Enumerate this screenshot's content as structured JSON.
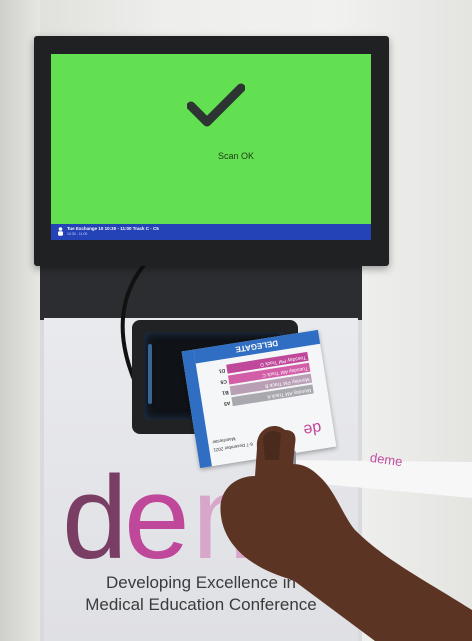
{
  "screen": {
    "status_text": "Scan OK",
    "session_line": "Tue Exchange 10 10:30 - 11:00 Track C - C5",
    "session_time": "10:30 - 11:00",
    "background_color": "#63e051",
    "icon": "checkmark-icon"
  },
  "badge": {
    "role": "DELEGATE",
    "rows": [
      {
        "track": "Monday AM Track A",
        "slot": "A5"
      },
      {
        "track": "Monday PM Track B",
        "slot": "B1"
      },
      {
        "track": "Tuesday AM Track C",
        "slot": "C5"
      },
      {
        "track": "Tuesday PM Track D",
        "slot": "D1"
      }
    ],
    "event_dates": "6-7 December 2021",
    "event_city": "Manchester",
    "accent_color": "#2f6ec2"
  },
  "stand": {
    "logo_text": "deme",
    "tagline_line1": "Developing Excellence in",
    "tagline_line2": "Medical Education Conference",
    "logo_color": "#7a3d63"
  },
  "lanyard": {
    "text": "deme"
  }
}
